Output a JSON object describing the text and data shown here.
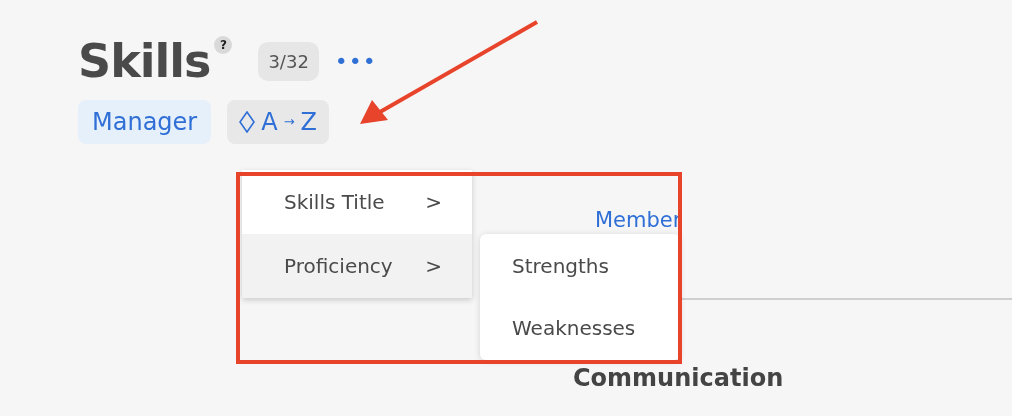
{
  "title": "Skills",
  "help": "?",
  "count": "3/32",
  "more": "•••",
  "role_chip": {
    "label": "Manager"
  },
  "sort_button": {
    "from": "A",
    "arrow": "→",
    "to": "Z"
  },
  "sort_menu": {
    "items": [
      {
        "label": "Skills Title",
        "chevron": ">",
        "selected": false
      },
      {
        "label": "Proficiency",
        "chevron": ">",
        "selected": true
      }
    ]
  },
  "submenu": {
    "items": [
      {
        "label": "Strengths"
      },
      {
        "label": "Weaknesses"
      }
    ]
  },
  "column_header": "Member",
  "row_label": "Communication"
}
